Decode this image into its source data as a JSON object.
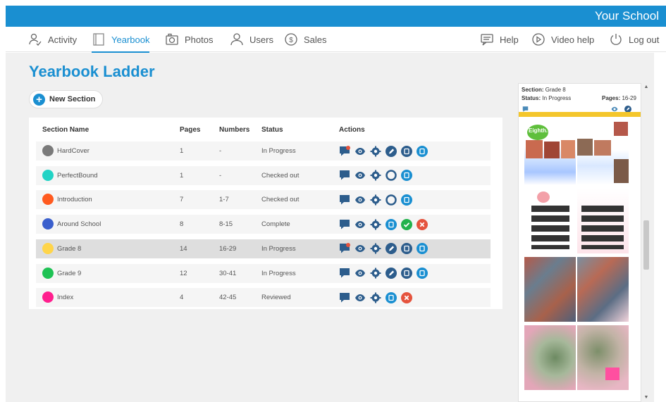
{
  "header": {
    "school_name": "Your School"
  },
  "nav": {
    "left": [
      {
        "label": "Activity",
        "icon": "users-icon"
      },
      {
        "label": "Yearbook",
        "icon": "book-icon"
      },
      {
        "label": "Photos",
        "icon": "camera-icon"
      },
      {
        "label": "Users",
        "icon": "user-icon"
      },
      {
        "label": "Sales",
        "icon": "dollar-icon"
      }
    ],
    "right": [
      {
        "label": "Help",
        "icon": "chat-icon"
      },
      {
        "label": "Video help",
        "icon": "play-icon"
      },
      {
        "label": "Log out",
        "icon": "power-icon"
      }
    ],
    "active": "Yearbook"
  },
  "page": {
    "title": "Yearbook Ladder",
    "new_section_label": "New Section"
  },
  "table": {
    "headers": {
      "name": "Section Name",
      "pages": "Pages",
      "numbers": "Numbers",
      "status": "Status",
      "actions": "Actions"
    },
    "rows": [
      {
        "name": "HardCover",
        "color": "#7a7a7a",
        "pages": "1",
        "numbers": "-",
        "status": "In Progress"
      },
      {
        "name": "PerfectBound",
        "color": "#22d3c5",
        "pages": "1",
        "numbers": "-",
        "status": "Checked out"
      },
      {
        "name": "Introduction",
        "color": "#ff5a1f",
        "pages": "7",
        "numbers": "1-7",
        "status": "Checked out"
      },
      {
        "name": "Around School",
        "color": "#3a5fcd",
        "pages": "8",
        "numbers": "8-15",
        "status": "Complete"
      },
      {
        "name": "Grade 8",
        "color": "#ffd54a",
        "pages": "14",
        "numbers": "16-29",
        "status": "In Progress"
      },
      {
        "name": "Grade 9",
        "color": "#1ec254",
        "pages": "12",
        "numbers": "30-41",
        "status": "In Progress"
      },
      {
        "name": "Index",
        "color": "#ff1f8e",
        "pages": "4",
        "numbers": "42-45",
        "status": "Reviewed"
      }
    ]
  },
  "preview": {
    "section_label": "Section:",
    "section_value": "Grade 8",
    "status_label": "Status:",
    "status_value": "In Progress",
    "pages_label": "Pages:",
    "pages_value": "16-29",
    "thumb_text": "Eighth."
  },
  "colors": {
    "accent": "#1a8fd1",
    "bar": "#f4c62b",
    "green": "#22b24c",
    "red": "#e5533d"
  }
}
